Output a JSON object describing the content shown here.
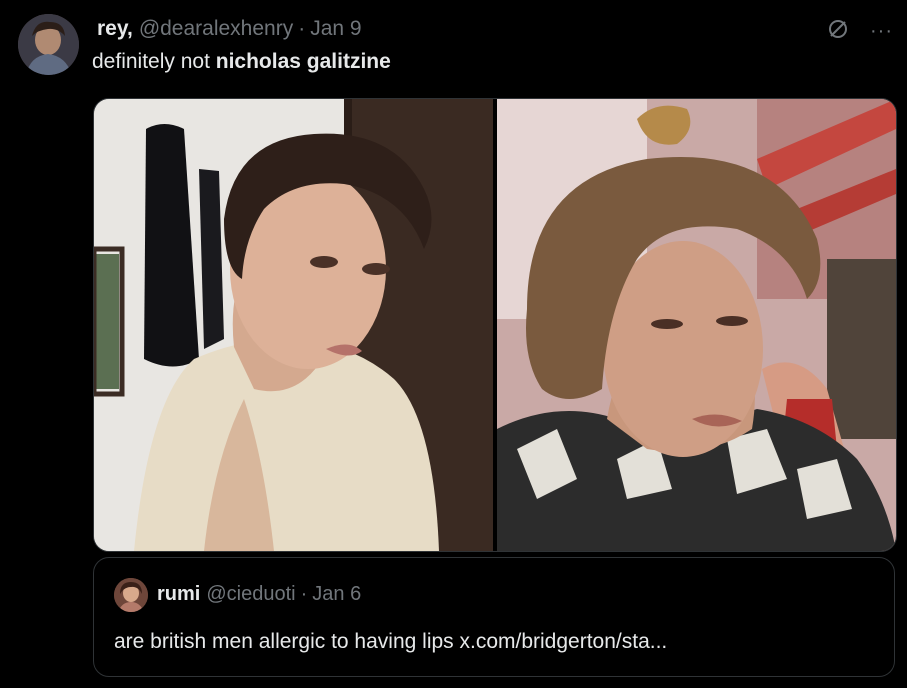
{
  "tweet": {
    "author": {
      "display_name": "rey,",
      "handle": "@dearalexhenry",
      "separator": "·",
      "date": "Jan 9"
    },
    "text_plain": "definitely not ",
    "text_bold": "nicholas galitzine",
    "icons": [
      "grok-icon",
      "more-icon"
    ],
    "more_glyph": "···"
  },
  "quote": {
    "author": {
      "display_name": "rumi",
      "handle": "@cieduoti",
      "separator": "·",
      "date": "Jan 6"
    },
    "text": "are british men allergic to having lips x.com/bridgerton/sta..."
  },
  "colors": {
    "background": "#000000",
    "text": "#e7e9ea",
    "muted": "#71767b",
    "border": "#2f3336"
  }
}
